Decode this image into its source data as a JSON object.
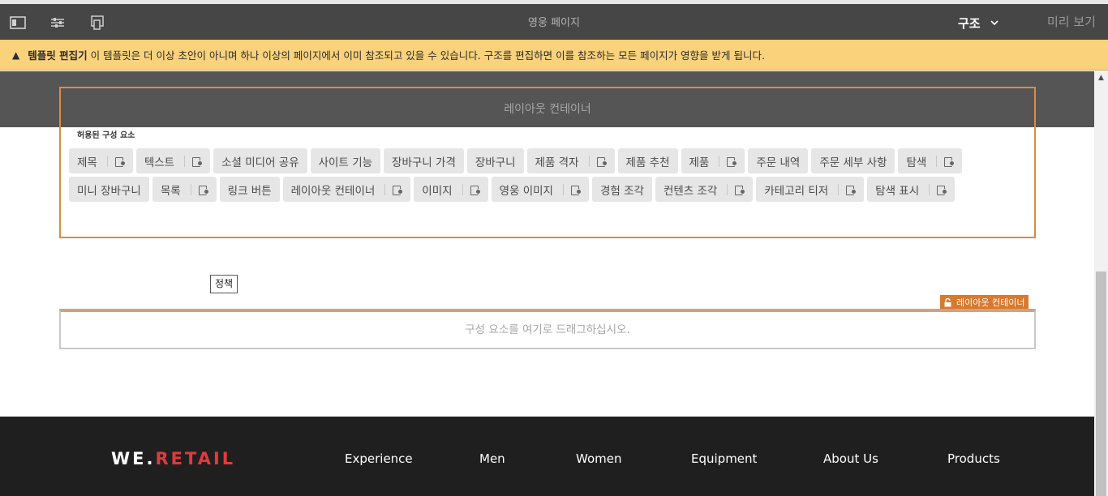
{
  "toolbar": {
    "title": "영웅 페이지",
    "mode_label": "구조",
    "preview_label": "미리 보기"
  },
  "warning": {
    "bold": "템플릿 편집기",
    "text": "이 템플릿은 더 이상 초안이 아니며 하나 이상의 페이지에서 이미 참조되고 있을 수 있습니다. 구조를 편집하면 이를 참조하는 모든 페이지가 영향을 받게 됩니다."
  },
  "layout_container": {
    "title": "레이아웃 컨테이너",
    "allowed_label": "허용된 구성 요소",
    "tag_label": "레이아웃 컨테이너",
    "row1": [
      {
        "label": "제목",
        "policy": true
      },
      {
        "label": "텍스트",
        "policy": true
      },
      {
        "label": "소셜 미디어 공유",
        "policy": false
      },
      {
        "label": "사이트 기능",
        "policy": false
      },
      {
        "label": "장바구니 가격",
        "policy": false
      },
      {
        "label": "장바구니",
        "policy": false
      },
      {
        "label": "제품 격자",
        "policy": true
      },
      {
        "label": "제품 추천",
        "policy": false
      },
      {
        "label": "제품",
        "policy": true
      },
      {
        "label": "주문 내역",
        "policy": false
      },
      {
        "label": "주문 세부 사항",
        "policy": false
      },
      {
        "label": "탐색",
        "policy": true
      }
    ],
    "row2": [
      {
        "label": "미니 장바구니",
        "policy": false
      },
      {
        "label": "목록",
        "policy": true
      },
      {
        "label": "링크 버튼",
        "policy": false
      },
      {
        "label": "레이아웃 컨테이너",
        "policy": true
      },
      {
        "label": "이미지",
        "policy": true
      },
      {
        "label": "영웅 이미지",
        "policy": true
      },
      {
        "label": "경험 조각",
        "policy": false
      },
      {
        "label": "컨텐츠 조각",
        "policy": true
      },
      {
        "label": "카테고리 티저",
        "policy": true
      },
      {
        "label": "탐색 표시",
        "policy": true
      }
    ],
    "tooltip": "정책"
  },
  "dropzone": {
    "text": "구성 요소를 여기로 드래그하십시오."
  },
  "footer": {
    "logo_we": "WE.",
    "logo_retail": "RETAIL",
    "nav": [
      "Experience",
      "Men",
      "Women",
      "Equipment",
      "About Us",
      "Products"
    ]
  }
}
